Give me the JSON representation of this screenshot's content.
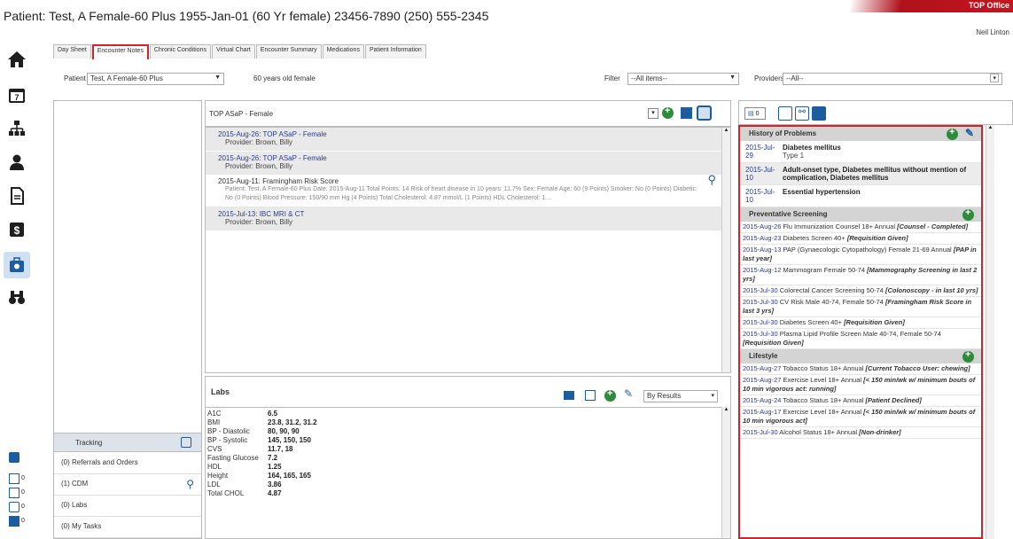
{
  "header": {
    "title": "Patient: Test, A Female-60 Plus 1955-Jan-01 (60 Yr female) 23456-7890 (250) 555-2345",
    "brand": "TOP Office",
    "user": "Neil Linton"
  },
  "tabs": [
    "Day Sheet",
    "Encounter Notes",
    "Chronic Conditions",
    "Virtual Chart",
    "Encounter Summary",
    "Medications",
    "Patient Information"
  ],
  "filterbar": {
    "patient_label": "Patient",
    "patient_value": "Test, A Female-60 Plus",
    "age_text": "60 years old female",
    "filter_label": "Filter",
    "filter_value": "--All items--",
    "providers_label": "Providers",
    "providers_value": "--All--"
  },
  "template_select": "TOP ASaP - Female",
  "encounters": [
    {
      "title": "2015-Aug-26: TOP ASaP - Female",
      "provider": "Provider: Brown, Billy",
      "detail": ""
    },
    {
      "title": "2015-Aug-26: TOP ASaP - Female",
      "provider": "Provider: Brown, Billy",
      "detail": ""
    },
    {
      "title": "2015-Aug-11: Framingham Risk Score",
      "provider": "",
      "detail": "Patient: Test, A Female-60 Plus Date: 2015-Aug-11   Total Points: 14  Risk of heart disease in 10 years: 11.7%  Sex: Female  Age: 60 (9 Points)  Smoker: No (0 Points)  Diabetic: No (0 Points)  Blood Pressure: 150/90 mm Hg (4 Points)  Total Cholesterol: 4.87 mmol/L (1 Points)  HDL Cholesterol: 1...."
    },
    {
      "title": "2015-Jul-13: IBC MRI & CT",
      "provider": "Provider: Brown, Billy",
      "detail": ""
    }
  ],
  "labs": {
    "title": "Labs",
    "sort_value": "By Results",
    "rows": [
      {
        "name": "A1C",
        "value": "6.5"
      },
      {
        "name": "BMI",
        "value": "23.8, 31.2, 31.2"
      },
      {
        "name": "BP - Diastolic",
        "value": "80, 90, 90"
      },
      {
        "name": "BP - Systolic",
        "value": "145, 150, 150"
      },
      {
        "name": "CVS",
        "value": "11.7, 18"
      },
      {
        "name": "Fasting Glucose",
        "value": "7.2"
      },
      {
        "name": "HDL",
        "value": "1.25"
      },
      {
        "name": "Height",
        "value": "164, 165, 165"
      },
      {
        "name": "LDL",
        "value": "3.86"
      },
      {
        "name": "Total CHOL",
        "value": "4.87"
      }
    ]
  },
  "tracking": {
    "title": "Tracking",
    "rows": [
      "(0) Referrals and Orders",
      "(1) CDM",
      "(0) Labs",
      "(0) My Tasks"
    ]
  },
  "right_toolbar": {
    "doc_count": "0"
  },
  "history": {
    "title": "History of Problems",
    "rows": [
      {
        "date": "2015-Jul-29",
        "name": "Diabetes mellitus",
        "type": "Type 1"
      },
      {
        "date": "2015-Jul-10",
        "name": "Adult-onset type, Diabetes mellitus without mention of complication, Diabetes mellitus",
        "type": ""
      },
      {
        "date": "2015-Jul-10",
        "name": "Essential hypertension",
        "type": ""
      }
    ]
  },
  "preventative": {
    "title": "Preventative Screening",
    "rows": [
      {
        "date": "2015-Aug-26",
        "text": "Flu Immunization Counsel 18+ Annual",
        "status": "[Counsel - Completed]"
      },
      {
        "date": "2015-Aug-23",
        "text": "Diabetes Screen 40+",
        "status": "[Requisition Given]"
      },
      {
        "date": "2015-Aug-13",
        "text": "PAP (Gynaecologic Cytopathology) Female 21-69 Annual",
        "status": "[PAP in last year]"
      },
      {
        "date": "2015-Aug-12",
        "text": "Mammogram Female 50-74",
        "status": "[Mammography Screening in last 2 yrs]"
      },
      {
        "date": "2015-Jul-30",
        "text": "Colorectal Cancer Screening 50-74",
        "status": "[Colonoscopy - in last 10 yrs]"
      },
      {
        "date": "2015-Jul-30",
        "text": "CV Risk Male 40-74, Female 50-74",
        "status": "[Framingham Risk Score in last 3 yrs]"
      },
      {
        "date": "2015-Jul-30",
        "text": "Diabetes Screen 40+",
        "status": "[Requisition Given]"
      },
      {
        "date": "2015-Jul-30",
        "text": "Plasma Lipid Profile Screen Male 40-74, Female 50-74",
        "status": "[Requisition Given]"
      }
    ]
  },
  "lifestyle": {
    "title": "Lifestyle",
    "rows": [
      {
        "date": "2015-Aug-27",
        "text": "Tobacco Status 18+ Annual",
        "status": "[Current Tobacco User: chewing]"
      },
      {
        "date": "2015-Aug-27",
        "text": "Exercise Level 18+ Annual",
        "status": "[< 150 min/wk w/ minimum bouts of 10 min vigorous act: running]"
      },
      {
        "date": "2015-Aug-24",
        "text": "Tobacco Status 18+ Annual",
        "status": "[Patient Declined]"
      },
      {
        "date": "2015-Aug-17",
        "text": "Exercise Level 18+ Annual",
        "status": "[< 150 min/wk w/ minimum bouts of 10 min vigorous act]"
      },
      {
        "date": "2015-Jul-30",
        "text": "Alcohol Status 18+ Annual",
        "status": "[Non-drinker]"
      }
    ]
  },
  "colors": {
    "accent_red": "#d0232a",
    "link_blue": "#2a3d8f",
    "green": "#2e8b3a",
    "nav_dark": "#1e1e1e",
    "nav_blue": "#1d5c9e"
  }
}
